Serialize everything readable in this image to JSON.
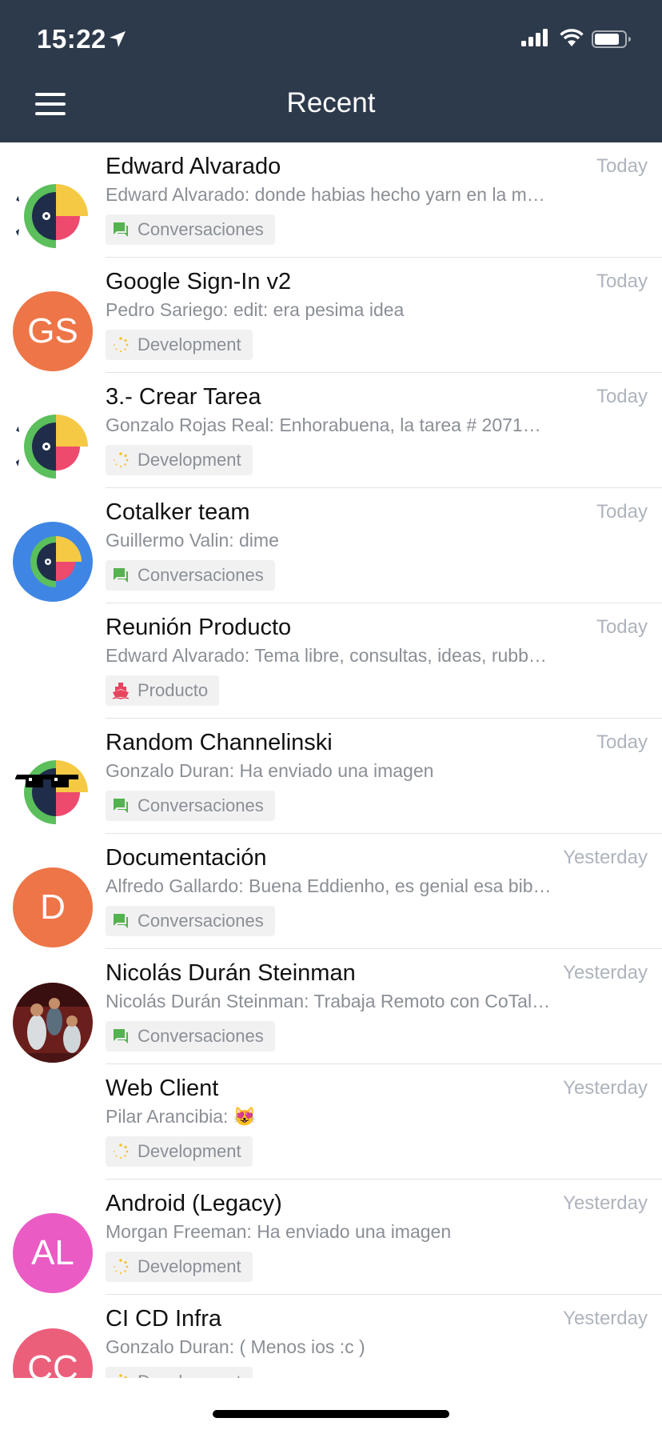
{
  "status_bar": {
    "time": "15:22"
  },
  "header": {
    "title": "Recent"
  },
  "colors": {
    "header_bg": "#2d3a4b",
    "orange_avatar": "#ee7547",
    "pink_avatar": "#ea5cc4",
    "rose_avatar": "#ec5f7b"
  },
  "chats": [
    {
      "title": "Edward Alvarado",
      "time": "Today",
      "preview": "Edward Alvarado: donde habias hecho yarn en la m…",
      "tag": "Conversaciones",
      "tag_icon": "chat-bubbles-icon",
      "avatar": "cotalker-logo"
    },
    {
      "title": "Google Sign-In v2",
      "time": "Today",
      "preview": "Pedro Sariego: edit: era pesima idea",
      "tag": "Development",
      "tag_icon": "spinner-icon",
      "avatar_initials": "GS"
    },
    {
      "title": "3.- Crear Tarea",
      "time": "Today",
      "preview": "Gonzalo Rojas Real: Enhorabuena, la tarea  # 2071…",
      "tag": "Development",
      "tag_icon": "spinner-icon",
      "avatar": "cotalker-logo"
    },
    {
      "title": "Cotalker team",
      "time": "Today",
      "preview": "Guillermo Valin: dime",
      "tag": "Conversaciones",
      "tag_icon": "chat-bubbles-icon",
      "avatar": "cotalker-logo-blue"
    },
    {
      "title": "Reunión Producto",
      "time": "Today",
      "preview": "Edward Alvarado: Tema libre, consultas, ideas, rubb…",
      "tag": "Producto",
      "tag_icon": "ship-icon",
      "avatar": "none"
    },
    {
      "title": "Random Channelinski",
      "time": "Today",
      "preview": "Gonzalo Duran: Ha enviado una imagen",
      "tag": "Conversaciones",
      "tag_icon": "chat-bubbles-icon",
      "avatar": "cotalker-logo-sunglasses"
    },
    {
      "title": "Documentación",
      "time": "Yesterday",
      "preview": "Alfredo Gallardo: Buena Eddienho, es genial esa bib…",
      "tag": "Conversaciones",
      "tag_icon": "chat-bubbles-icon",
      "avatar_initials": "D"
    },
    {
      "title": "Nicolás Durán Steinman",
      "time": "Yesterday",
      "preview": "Nicolás Durán Steinman: Trabaja Remoto con CoTal…",
      "tag": "Conversaciones",
      "tag_icon": "chat-bubbles-icon",
      "avatar": "photo"
    },
    {
      "title": "Web Client",
      "time": "Yesterday",
      "preview": "Pilar Arancibia: 😻",
      "tag": "Development",
      "tag_icon": "spinner-icon",
      "avatar": "none"
    },
    {
      "title": "Android (Legacy)",
      "time": "Yesterday",
      "preview": "Morgan Freeman: Ha enviado una imagen",
      "tag": "Development",
      "tag_icon": "spinner-icon",
      "avatar_initials": "AL"
    },
    {
      "title": "CI CD Infra",
      "time": "Yesterday",
      "preview": "Gonzalo Duran: ( Menos ios :c )",
      "tag": "Development",
      "tag_icon": "spinner-icon",
      "avatar_initials": "CC"
    }
  ]
}
